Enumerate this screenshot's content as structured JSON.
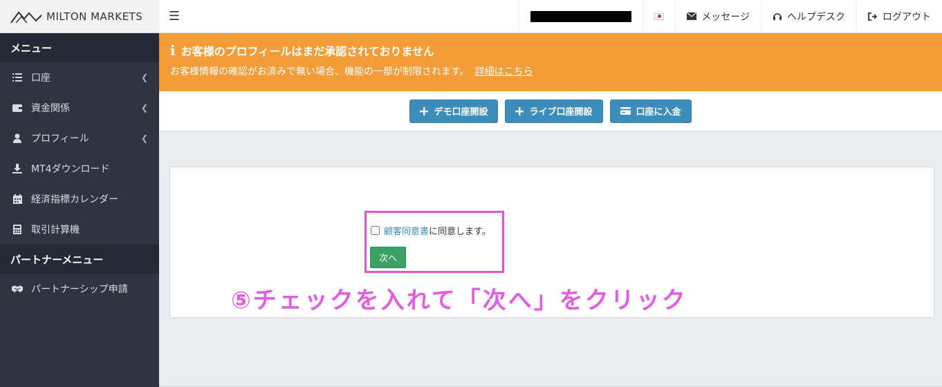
{
  "brand": {
    "name": "MILTON MARKETS"
  },
  "sidebar": {
    "menu_header": "メニュー",
    "items": [
      {
        "label": "口座",
        "icon": "list-icon",
        "has_submenu": true
      },
      {
        "label": "資金関係",
        "icon": "wallet-icon",
        "has_submenu": true
      },
      {
        "label": "プロフィール",
        "icon": "user-icon",
        "has_submenu": true
      },
      {
        "label": "MT4ダウンロード",
        "icon": "download-icon",
        "has_submenu": false
      },
      {
        "label": "経済指標カレンダー",
        "icon": "calendar-icon",
        "has_submenu": false
      },
      {
        "label": "取引計算機",
        "icon": "calculator-icon",
        "has_submenu": false
      }
    ],
    "partner_header": "パートナーメニュー",
    "partner_items": [
      {
        "label": "パートナーシップ申請",
        "icon": "handshake-icon"
      }
    ]
  },
  "topbar": {
    "language_flag": "japan-flag-icon",
    "messages_label": "メッセージ",
    "helpdesk_label": "ヘルプデスク",
    "logout_label": "ログアウト"
  },
  "alert": {
    "title": "お客様のプロフィールはまだ承認されておりません",
    "body": "お客様情報の確認がお済みで無い場合、機能の一部が制限されます。",
    "link_label": "詳細はこちら",
    "color": "#f39c38"
  },
  "actions": {
    "demo_label": "デモ口座開設",
    "live_label": "ライブ口座開設",
    "deposit_label": "口座に入金",
    "color": "#3c8dbc"
  },
  "consent": {
    "checked": false,
    "link_label": "顧客同意書",
    "suffix": "に同意します。",
    "next_label": "次へ"
  },
  "annotation": {
    "text": "⑤チェックを入れて「次へ」をクリック",
    "color": "#e25ce2"
  }
}
